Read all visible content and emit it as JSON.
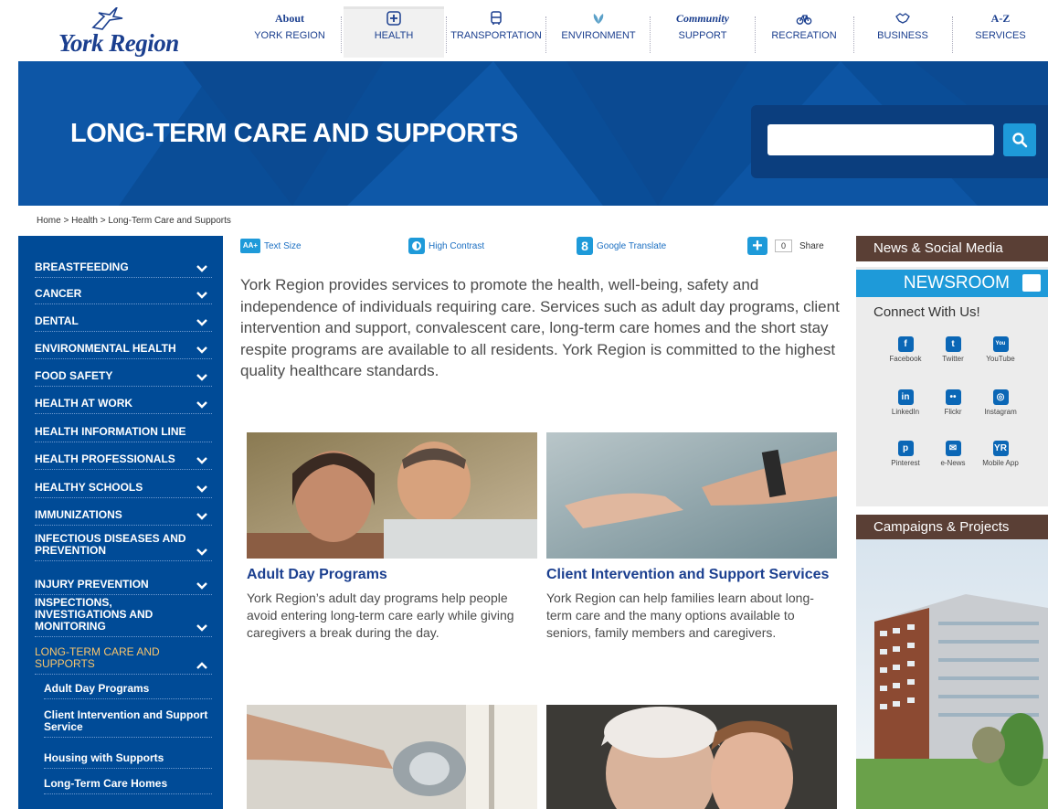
{
  "nav": {
    "logo_text": "York Region",
    "items": [
      {
        "top": "About",
        "bottom": "YORK REGION",
        "icon": "text"
      },
      {
        "top": "",
        "bottom": "HEALTH",
        "icon": "health-icon"
      },
      {
        "top": "",
        "bottom": "TRANSPORTATION",
        "icon": "bus-icon"
      },
      {
        "top": "",
        "bottom": "ENVIRONMENT",
        "icon": "leaf-icon"
      },
      {
        "top": "Community",
        "bottom": "SUPPORT",
        "icon": "text"
      },
      {
        "top": "",
        "bottom": "RECREATION",
        "icon": "bicycle-icon"
      },
      {
        "top": "",
        "bottom": "BUSINESS",
        "icon": "handshake-icon"
      },
      {
        "top": "A-Z",
        "bottom": "SERVICES",
        "icon": "text"
      }
    ]
  },
  "banner": {
    "title": "LONG-TERM CARE AND SUPPORTS",
    "search_value": ""
  },
  "breadcrumb": "Home > Health > Long-Term Care and Supports",
  "sidebar": {
    "items": [
      {
        "label": "BREASTFEEDING",
        "chevron": "down"
      },
      {
        "label": "CANCER",
        "chevron": "down"
      },
      {
        "label": "DENTAL",
        "chevron": "down"
      },
      {
        "label": "ENVIRONMENTAL HEALTH",
        "chevron": "down"
      },
      {
        "label": "FOOD SAFETY",
        "chevron": "down"
      },
      {
        "label": "HEALTH AT WORK",
        "chevron": "down"
      },
      {
        "label": "HEALTH INFORMATION LINE",
        "chevron": ""
      },
      {
        "label": "HEALTH PROFESSIONALS",
        "chevron": "down"
      },
      {
        "label": "HEALTHY SCHOOLS",
        "chevron": "down"
      },
      {
        "label": "IMMUNIZATIONS",
        "chevron": "down"
      },
      {
        "label": "INFECTIOUS DISEASES AND PREVENTION",
        "chevron": "down"
      },
      {
        "label": "INJURY PREVENTION",
        "chevron": "down"
      },
      {
        "label": "INSPECTIONS, INVESTIGATIONS AND MONITORING",
        "chevron": "down"
      },
      {
        "label": "LONG-TERM CARE AND SUPPORTS",
        "chevron": "up"
      }
    ],
    "subitems": [
      "Adult Day Programs",
      "Client Intervention and Support Service",
      "Housing with Supports",
      "Long-Term Care Homes"
    ]
  },
  "utility": {
    "text_size": "Text Size",
    "high_contrast": "High Contrast",
    "google_translate": "Google Translate",
    "share_count": "0",
    "share": "Share"
  },
  "intro": "York Region provides services to promote the health, well-being, safety and independence of individuals requiring care. Services such as adult day programs, client intervention and support, convalescent care, long-term care homes and the short stay respite programs are available to all residents. York Region is committed to the highest quality healthcare standards.",
  "cards": [
    {
      "title": "Adult Day Programs",
      "text": "York Region’s adult day programs help people avoid entering long-term care early while giving caregivers a break during the day."
    },
    {
      "title": "Client Intervention and Support Services",
      "text": "York Region can help families learn about long-term care and the many options available to seniors, family members and caregivers."
    }
  ],
  "right": {
    "news_heading": "News & Social Media",
    "newsroom": "NEWSROOM",
    "connect": "Connect With Us!",
    "social": [
      {
        "label": "Facebook",
        "glyph": "f",
        "icon": "facebook-icon"
      },
      {
        "label": "Twitter",
        "glyph": "t",
        "icon": "twitter-icon"
      },
      {
        "label": "YouTube",
        "glyph": "You",
        "icon": "youtube-icon"
      },
      {
        "label": "LinkedIn",
        "glyph": "in",
        "icon": "linkedin-icon"
      },
      {
        "label": "Flickr",
        "glyph": "••",
        "icon": "flickr-icon"
      },
      {
        "label": "Instagram",
        "glyph": "◎",
        "icon": "instagram-icon"
      },
      {
        "label": "Pinterest",
        "glyph": "p",
        "icon": "pinterest-icon"
      },
      {
        "label": "e-News",
        "glyph": "✉",
        "icon": "enews-icon"
      },
      {
        "label": "Mobile App",
        "glyph": "YR",
        "icon": "mobile-app-icon"
      }
    ],
    "campaigns_heading": "Campaigns & Projects"
  },
  "colors": {
    "brand_blue": "#004b97",
    "accent_blue": "#1e9ad9",
    "heading_brown": "#5a3f35",
    "open_item": "#f7c46c"
  }
}
